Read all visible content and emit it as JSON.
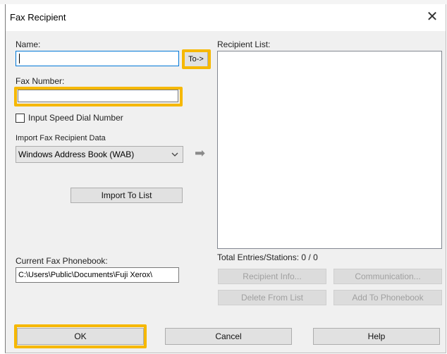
{
  "window": {
    "title": "Fax Recipient",
    "close_glyph": "✕"
  },
  "name": {
    "label": "Name:",
    "value": ""
  },
  "to_button": {
    "label": "To->"
  },
  "fax_number": {
    "label": "Fax Number:",
    "value": ""
  },
  "speed_dial": {
    "label": "Input Speed Dial Number",
    "checked": false
  },
  "import": {
    "label": "Import Fax Recipient Data",
    "selected": "Windows Address Book (WAB)",
    "dropdown_glyph": "chevron-down-icon",
    "arrow_glyph": "➡",
    "button": "Import To List"
  },
  "phonebook": {
    "label": "Current Fax Phonebook:",
    "value": "C:\\Users\\Public\\Documents\\Fuji Xerox\\"
  },
  "recipient_list": {
    "label": "Recipient List:",
    "total": "Total Entries/Stations: 0 / 0"
  },
  "actions": {
    "recipient_info": "Recipient Info...",
    "communication": "Communication...",
    "delete_from_list": "Delete From List",
    "add_to_phonebook": "Add To Phonebook"
  },
  "footer": {
    "ok": "OK",
    "cancel": "Cancel",
    "help": "Help"
  },
  "colors": {
    "highlight": "#f6b800",
    "dialog_bg": "#f0f0f0",
    "disabled_text": "#a0a0a0"
  }
}
